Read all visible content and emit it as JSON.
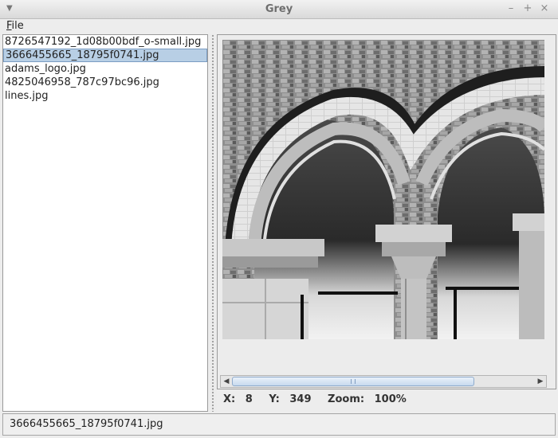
{
  "window": {
    "title": "Grey"
  },
  "menu": {
    "file_mnemonic": "F",
    "file_rest": "ile"
  },
  "file_list": {
    "items": [
      "8726547192_1d08b00bdf_o-small.jpg",
      "3666455665_18795f0741.jpg",
      "adams_logo.jpg",
      "4825046958_787c97bc96.jpg",
      "lines.jpg"
    ],
    "selected_index": 1
  },
  "viewer": {
    "x_label": "X:",
    "x_value": "8",
    "y_label": "Y:",
    "y_value": "349",
    "zoom_label": "Zoom:",
    "zoom_value": "100%"
  },
  "status": {
    "text": "3666455665_18795f0741.jpg"
  },
  "icons": {
    "window_menu": "window-menu-icon",
    "minimize": "minimize-icon",
    "maximize": "maximize-icon",
    "close": "close-icon",
    "scroll_left": "arrow-left-icon",
    "scroll_right": "arrow-right-icon"
  },
  "colors": {
    "selection": "#b8cfe5",
    "scroll_thumb": "#c7d9ee"
  }
}
